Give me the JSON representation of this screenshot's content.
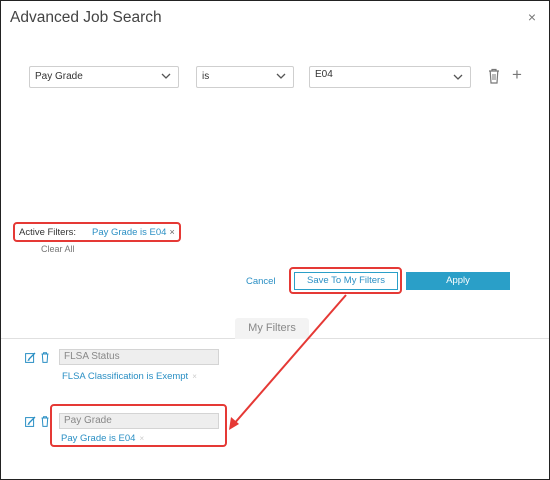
{
  "dialog": {
    "title": "Advanced Job Search",
    "close_symbol": "×"
  },
  "filter_row": {
    "field_value": "Pay Grade",
    "operator_value": "is",
    "value_value": "E04",
    "add_symbol": "+"
  },
  "active_filters": {
    "label": "Active Filters:",
    "chip_text": "Pay Grade is E04",
    "chip_remove": "×",
    "clear_all": "Clear All"
  },
  "actions": {
    "cancel": "Cancel",
    "save": "Save To My Filters",
    "apply": "Apply"
  },
  "my_filters": {
    "tab_label": "My Filters",
    "items": [
      {
        "name": "FLSA Status",
        "description": "FLSA Classification is Exempt",
        "remove": "×"
      },
      {
        "name": "Pay Grade",
        "description": "Pay Grade is E04",
        "remove": "×"
      }
    ]
  },
  "colors": {
    "accent": "#2a9fc8",
    "highlight": "#e53935",
    "link": "#2a8fc4"
  }
}
